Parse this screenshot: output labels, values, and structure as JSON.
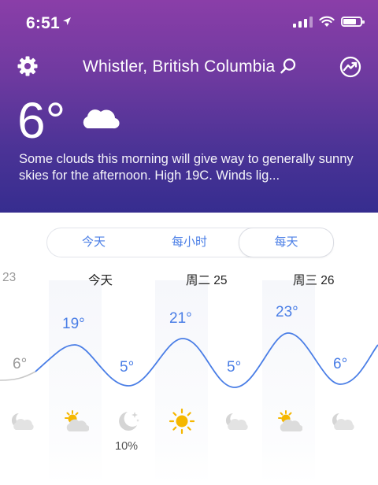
{
  "status": {
    "time": "6:51"
  },
  "header": {
    "location": "Whistler, British Columbia",
    "temperature": "6°",
    "summary": "Some clouds this morning will give way to generally sunny skies for the afternoon. High 19C. Winds lig..."
  },
  "tabs": [
    {
      "label": "今天",
      "active": false
    },
    {
      "label": "每小时",
      "active": false
    },
    {
      "label": "每天",
      "active": true
    }
  ],
  "forecast": {
    "day_labels": [
      "23",
      "今天",
      "周二 25",
      "周三 26"
    ],
    "temps": [
      "6°",
      "19°",
      "5°",
      "21°",
      "5°",
      "23°",
      "6°"
    ],
    "icons": [
      "partly-cloudy-night-icon",
      "partly-sunny-icon",
      "clear-night-icon",
      "sunny-icon",
      "partly-cloudy-night-icon",
      "partly-sunny-icon",
      "partly-cloudy-night-icon"
    ],
    "precip": "10%"
  },
  "colors": {
    "accent": "#4a7ee6",
    "header_top": "#8a3ea8",
    "header_bottom": "#362d8f"
  }
}
